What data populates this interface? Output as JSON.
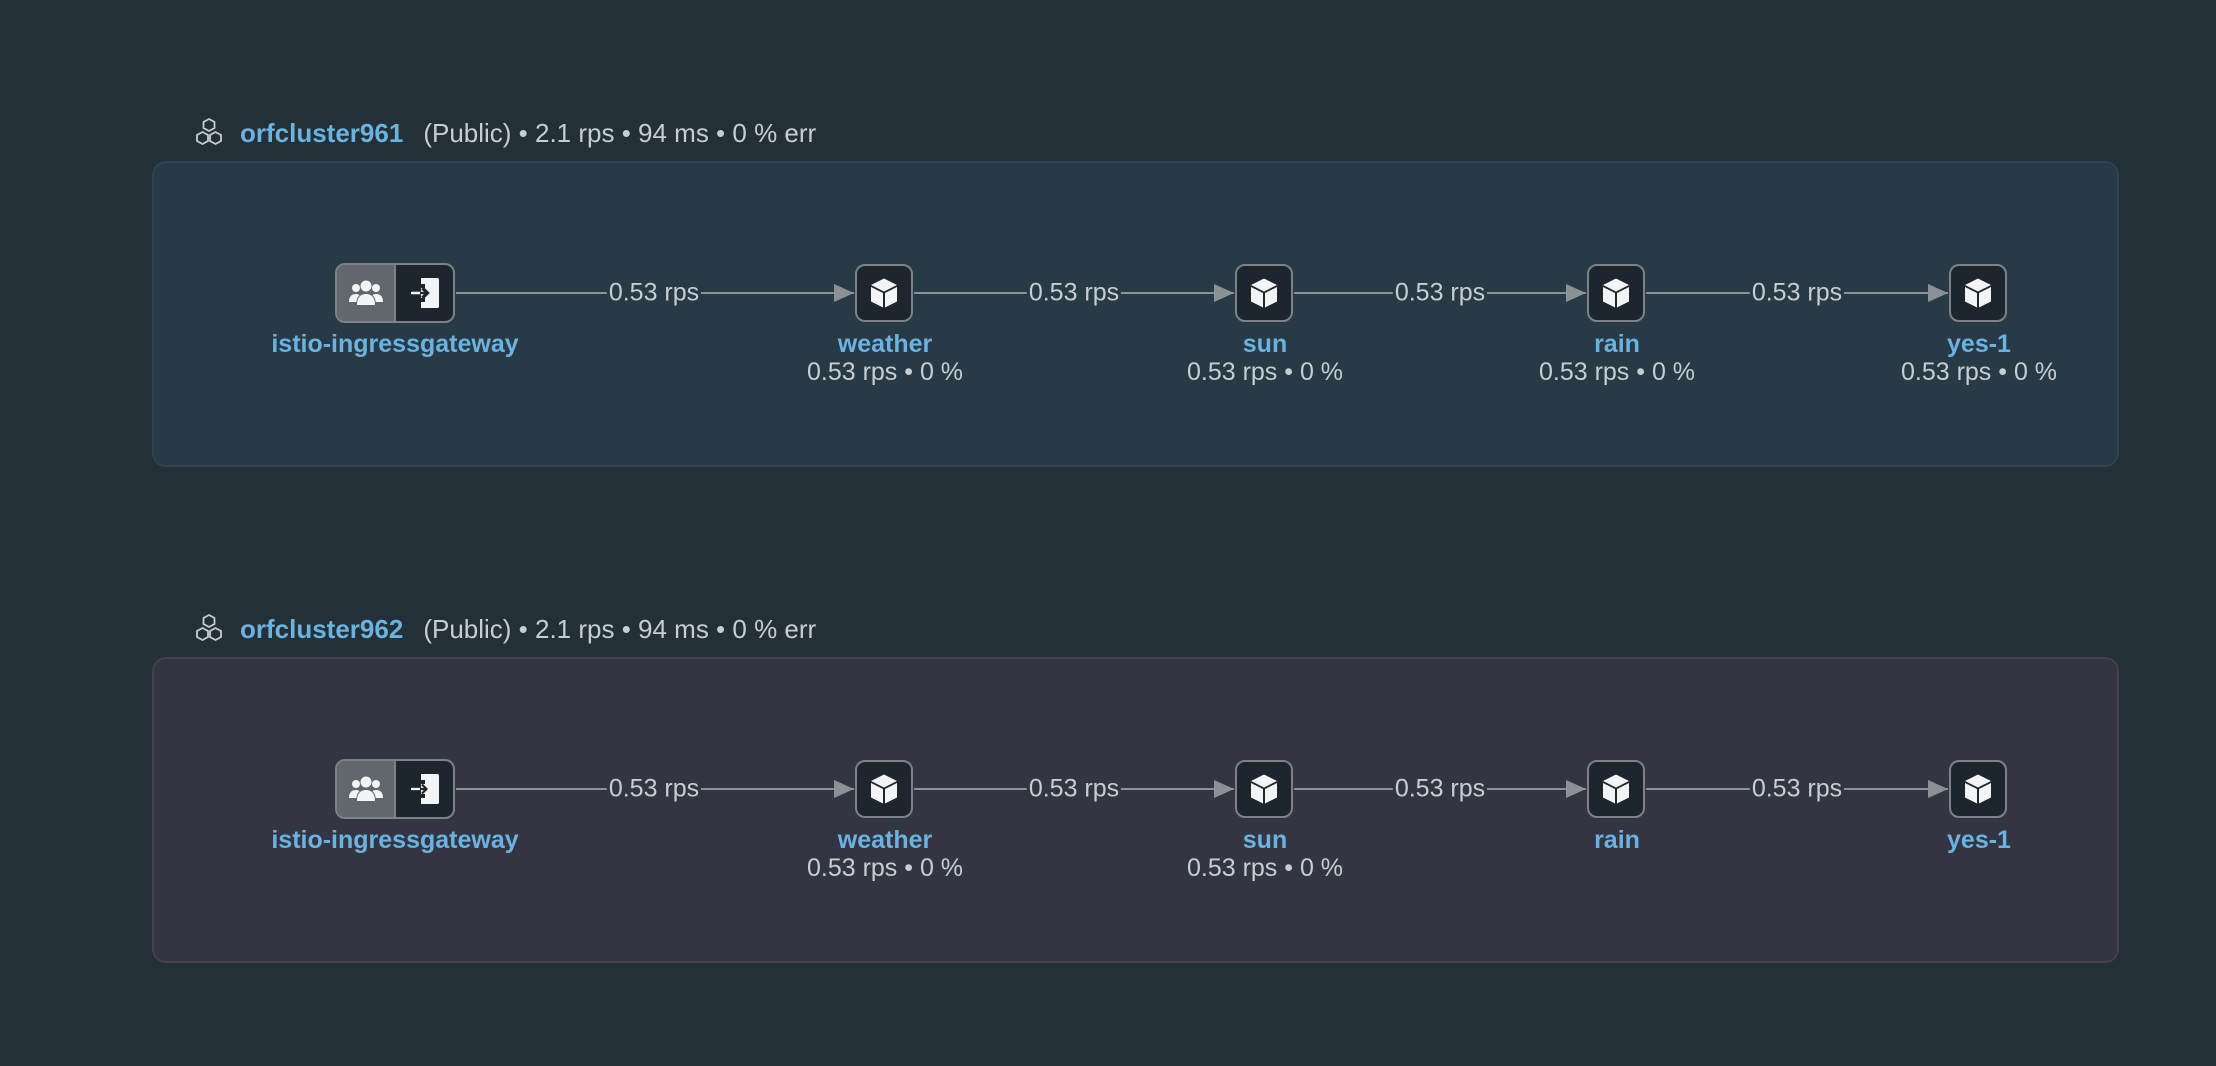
{
  "clusters": [
    {
      "name": "orfcluster961",
      "meta": "(Public) • 2.1 rps • 94 ms • 0 % err",
      "style": "blue",
      "gateway": {
        "name": "istio-ingressgateway"
      },
      "edges": [
        "0.53 rps",
        "0.53 rps",
        "0.53 rps",
        "0.53 rps"
      ],
      "services": [
        {
          "name": "weather",
          "stats": "0.53 rps • 0 %"
        },
        {
          "name": "sun",
          "stats": "0.53 rps • 0 %"
        },
        {
          "name": "rain",
          "stats": "0.53 rps • 0 %"
        },
        {
          "name": "yes-1",
          "stats": "0.53 rps • 0 %"
        }
      ]
    },
    {
      "name": "orfcluster962",
      "meta": "(Public) • 2.1 rps • 94 ms • 0 % err",
      "style": "gray",
      "gateway": {
        "name": "istio-ingressgateway"
      },
      "edges": [
        "0.53 rps",
        "0.53 rps",
        "0.53 rps",
        "0.53 rps"
      ],
      "services": [
        {
          "name": "weather",
          "stats": "0.53 rps • 0 %"
        },
        {
          "name": "sun",
          "stats": "0.53 rps • 0 %"
        },
        {
          "name": "rain",
          "stats": ""
        },
        {
          "name": "yes-1",
          "stats": ""
        }
      ]
    }
  ],
  "icons": {
    "cluster": "hexagon-cluster-icon",
    "gateway_users": "users-icon",
    "gateway_entry": "sign-in-icon",
    "service": "cube-icon"
  },
  "colors": {
    "background": "#233038",
    "link": "#6cb2e0",
    "cluster_box_blue": "#273a46",
    "cluster_box_gray": "#333642"
  }
}
